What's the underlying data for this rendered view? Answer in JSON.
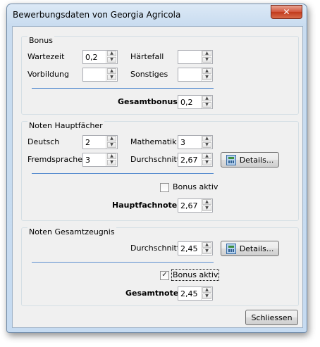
{
  "window": {
    "title": "Bewerbungsdaten von Georgia Agricola",
    "close_glyph": "✕"
  },
  "bonus": {
    "title": "Bonus",
    "wartezeit_label": "Wartezeit",
    "wartezeit_value": "0,2",
    "haertefall_label": "Härtefall",
    "haertefall_value": "",
    "vorbildung_label": "Vorbildung",
    "vorbildung_value": "",
    "sonstiges_label": "Sonstiges",
    "sonstiges_value": "",
    "gesamt_label": "Gesamtbonus",
    "gesamt_value": "0,2"
  },
  "haupt": {
    "title": "Noten Hauptfächer",
    "deutsch_label": "Deutsch",
    "deutsch_value": "2",
    "mathe_label": "Mathematik",
    "mathe_value": "3",
    "fremd_label": "Fremdsprache",
    "fremd_value": "3",
    "durch_label": "Durchschnitt",
    "durch_value": "2,67",
    "details_label": "Details...",
    "bonus_aktiv_label": "Bonus aktiv",
    "bonus_aktiv_checked": false,
    "note_label": "Hauptfachnote",
    "note_value": "2,67"
  },
  "gesamt": {
    "title": "Noten Gesamtzeugnis",
    "durch_label": "Durchschnitt",
    "durch_value": "2,45",
    "details_label": "Details...",
    "bonus_aktiv_label": "Bonus aktiv",
    "bonus_aktiv_checked": true,
    "check_glyph": "✓",
    "note_label": "Gesamtnote",
    "note_value": "2,45"
  },
  "footer": {
    "close_label": "Schliessen"
  },
  "icons": {
    "spin_up": "▲",
    "spin_down": "▼",
    "details": "calculator-icon"
  }
}
